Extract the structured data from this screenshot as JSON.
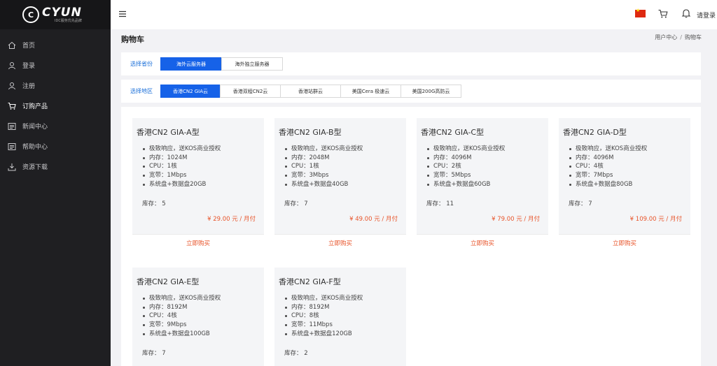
{
  "brand": {
    "name": "CYUN",
    "subtitle": "IDC服务优先品牌"
  },
  "sidebar": {
    "items": [
      {
        "label": "首页",
        "icon": "home-icon"
      },
      {
        "label": "登录",
        "icon": "user-icon"
      },
      {
        "label": "注册",
        "icon": "user-add-icon"
      },
      {
        "label": "订购产品",
        "icon": "cart-icon",
        "active": true
      },
      {
        "label": "新闻中心",
        "icon": "news-icon"
      },
      {
        "label": "帮助中心",
        "icon": "help-icon"
      },
      {
        "label": "资源下载",
        "icon": "download-icon"
      }
    ]
  },
  "topbar": {
    "login_label": "请登录",
    "flag": "cn-flag"
  },
  "page": {
    "title": "购物车"
  },
  "breadcrumb": {
    "items": [
      "用户中心",
      "购物车"
    ]
  },
  "filters": {
    "province": {
      "label": "选择省份",
      "options": [
        "海外云服务器",
        "海外独立服务器"
      ],
      "selected": 0
    },
    "region": {
      "label": "选择地区",
      "options": [
        "香港CN2 GIA云",
        "香港双程CN2云",
        "香港站群云",
        "美国Cera 极速云",
        "美国200G高防云"
      ],
      "selected": 0
    }
  },
  "products": [
    {
      "title": "香港CN2 GIA-A型",
      "features": [
        "极致响应，送KOS商业授权",
        "内存：1024M",
        "CPU：1核",
        "宽带：1Mbps",
        "系统盘+数据盘20GB"
      ],
      "stock": "库存：  5",
      "price": "¥ 29.00 元 / 月付",
      "buy": "立即购买"
    },
    {
      "title": "香港CN2 GIA-B型",
      "features": [
        "极致响应，送KOS商业授权",
        "内存：2048M",
        "CPU：1核",
        "宽带：3Mbps",
        "系统盘+数据盘40GB"
      ],
      "stock": "库存：  7",
      "price": "¥ 49.00 元 / 月付",
      "buy": "立即购买"
    },
    {
      "title": "香港CN2 GIA-C型",
      "features": [
        "极致响应，送KOS商业授权",
        "内存：4096M",
        "CPU：2核",
        "宽带：5Mbps",
        "系统盘+数据盘60GB"
      ],
      "stock": "库存：  11",
      "price": "¥ 79.00 元 / 月付",
      "buy": "立即购买"
    },
    {
      "title": "香港CN2 GIA-D型",
      "features": [
        "极致响应，送KOS商业授权",
        "内存：4096M",
        "CPU：4核",
        "宽带：7Mbps",
        "系统盘+数据盘80GB"
      ],
      "stock": "库存：  7",
      "price": "¥ 109.00 元 / 月付",
      "buy": "立即购买"
    },
    {
      "title": "香港CN2 GIA-E型",
      "features": [
        "极致响应，送KOS商业授权",
        "内存：8192M",
        "CPU：4核",
        "宽带：9Mbps",
        "系统盘+数据盘100GB"
      ],
      "stock": "库存：  7",
      "price": "",
      "buy": ""
    },
    {
      "title": "香港CN2 GIA-F型",
      "features": [
        "极致响应，送KOS商业授权",
        "内存：8192M",
        "CPU：8核",
        "宽带：11Mbps",
        "系统盘+数据盘120GB"
      ],
      "stock": "库存：  2",
      "price": "",
      "buy": ""
    }
  ],
  "colors": {
    "accent": "#1662e8",
    "price": "#e8542a",
    "sidebar_bg": "#1f1f22"
  }
}
